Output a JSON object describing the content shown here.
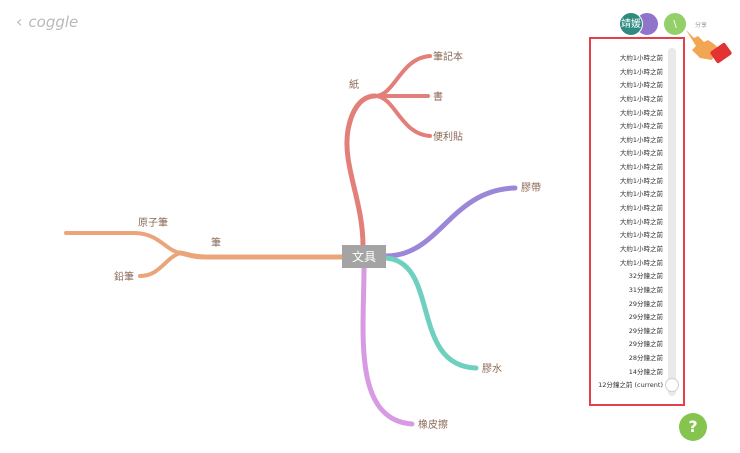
{
  "app": {
    "brand": "coggle"
  },
  "mindmap": {
    "center": "文具",
    "branches": {
      "paper": {
        "label": "紙",
        "children": [
          "筆記本",
          "書",
          "便利貼"
        ]
      },
      "tape": {
        "label": "膠帶"
      },
      "glue": {
        "label": "膠水"
      },
      "eraser": {
        "label": "橡皮擦"
      },
      "pen": {
        "label": "筆",
        "children": [
          "原子筆",
          "鉛筆"
        ]
      }
    },
    "colors": {
      "paper": "#e27f78",
      "tape": "#9b86d8",
      "glue": "#6fd0c0",
      "eraser": "#d89be3",
      "pen": "#eba57a"
    }
  },
  "collaborators": [
    {
      "initials": "靖媛",
      "color": "#2f8a80"
    },
    {
      "initials": "",
      "color": "#8f74c9"
    },
    {
      "initials": "\\",
      "color": "#93d06a"
    }
  ],
  "share": {
    "label": "分享"
  },
  "history": {
    "entries": [
      "大約1小時之前",
      "大約1小時之前",
      "大約1小時之前",
      "大約1小時之前",
      "大約1小時之前",
      "大約1小時之前",
      "大約1小時之前",
      "大約1小時之前",
      "大約1小時之前",
      "大約1小時之前",
      "大約1小時之前",
      "大約1小時之前",
      "大約1小時之前",
      "大約1小時之前",
      "大約1小時之前",
      "大約1小時之前",
      "32分鐘之前",
      "31分鐘之前",
      "29分鐘之前",
      "29分鐘之前",
      "29分鐘之前",
      "29分鐘之前",
      "28分鐘之前",
      "14分鐘之前",
      "12分鐘之前 (current)"
    ],
    "highlight_color": "#e43f4a"
  },
  "help": {
    "label": "?"
  }
}
